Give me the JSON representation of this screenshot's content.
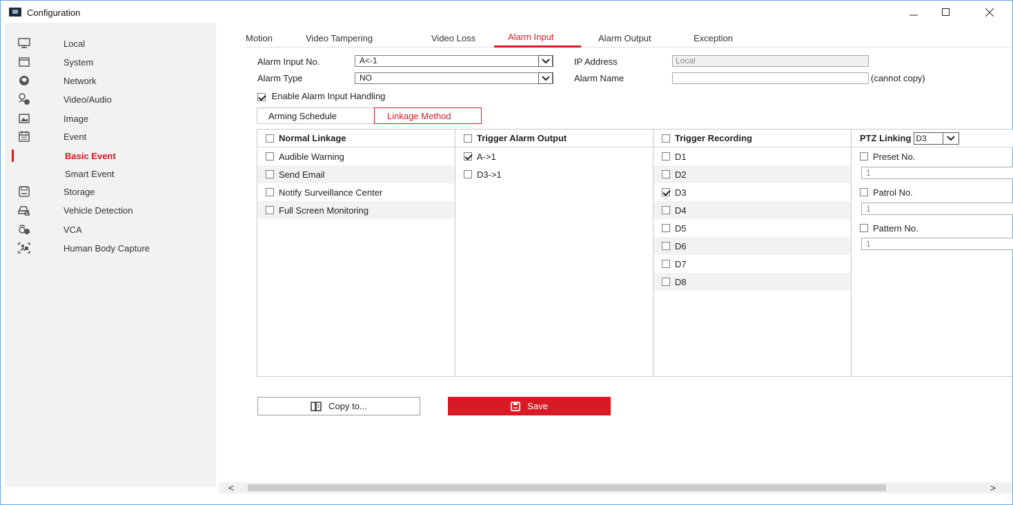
{
  "window": {
    "title": "Configuration",
    "minimize": "—",
    "maximize": "☐",
    "close": "✕"
  },
  "sidebar": {
    "items": [
      {
        "label": "Local",
        "icon": "monitor-icon"
      },
      {
        "label": "System",
        "icon": "system-icon"
      },
      {
        "label": "Network",
        "icon": "globe-icon"
      },
      {
        "label": "Video/Audio",
        "icon": "video-audio-icon"
      },
      {
        "label": "Image",
        "icon": "image-icon"
      },
      {
        "label": "Event",
        "icon": "calendar-icon"
      },
      {
        "label": "Basic Event",
        "icon": ""
      },
      {
        "label": "Smart Event",
        "icon": ""
      },
      {
        "label": "Storage",
        "icon": "storage-icon"
      },
      {
        "label": "Vehicle Detection",
        "icon": "vehicle-icon"
      },
      {
        "label": "VCA",
        "icon": "vca-icon"
      },
      {
        "label": "Human Body Capture",
        "icon": "human-body-icon"
      }
    ],
    "active": "Basic Event"
  },
  "tabs": [
    "Motion",
    "Video Tampering",
    "Video Loss",
    "Alarm Input",
    "Alarm Output",
    "Exception"
  ],
  "active_tab": "Alarm Input",
  "form": {
    "alarm_input_no_label": "Alarm Input No.",
    "alarm_input_no_value": "A<-1",
    "alarm_type_label": "Alarm Type",
    "alarm_type_value": "NO",
    "ip_address_label": "IP Address",
    "ip_address_value": "Local",
    "alarm_name_label": "Alarm Name",
    "alarm_name_value": "",
    "cannot_copy": "(cannot copy)",
    "enable_label": "Enable Alarm Input Handling",
    "enable_checked": true
  },
  "subtabs": [
    "Arming Schedule",
    "Linkage Method"
  ],
  "active_subtab": "Linkage Method",
  "linkage": {
    "normal": {
      "header": "Normal Linkage",
      "items": [
        "Audible Warning",
        "Send Email",
        "Notify Surveillance Center",
        "Full Screen Monitoring"
      ]
    },
    "alarm_output": {
      "header": "Trigger Alarm Output",
      "items": [
        {
          "label": "A->1",
          "checked": true
        },
        {
          "label": "D3->1",
          "checked": false
        }
      ]
    },
    "recording": {
      "header": "Trigger Recording",
      "items": [
        {
          "label": "D1",
          "checked": false
        },
        {
          "label": "D2",
          "checked": false
        },
        {
          "label": "D3",
          "checked": true
        },
        {
          "label": "D4",
          "checked": false
        },
        {
          "label": "D5",
          "checked": false
        },
        {
          "label": "D6",
          "checked": false
        },
        {
          "label": "D7",
          "checked": false
        },
        {
          "label": "D8",
          "checked": false
        }
      ]
    },
    "ptz": {
      "header": "PTZ Linking",
      "channel": "D3",
      "preset_label": "Preset No.",
      "preset_value": "1",
      "patrol_label": "Patrol No.",
      "patrol_value": "1",
      "pattern_label": "Pattern No.",
      "pattern_value": "1"
    }
  },
  "buttons": {
    "copy": "Copy to...",
    "save": "Save"
  },
  "colors": {
    "accent": "#d91a24",
    "sidebar_bg": "#f2f2f2"
  }
}
